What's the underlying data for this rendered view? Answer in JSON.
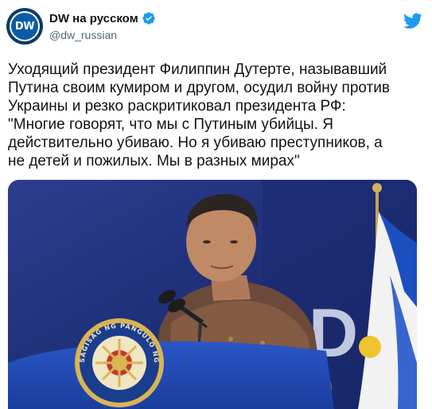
{
  "account": {
    "display_name": "DW на русском",
    "handle": "@dw_russian",
    "avatar_text": "DW",
    "verified": true
  },
  "tweet": {
    "text": "Уходящий президент Филиппин Дутерте, называвший\nПутина своим кумиром и другом, осудил войну против\nУкраины и резко раскритиковал президента РФ:\n\"Многие говорят, что мы с Путиным убийцы. Я\nдействительно убиваю. Но я убиваю преступников, а\nне детей и пожилых. Мы в разных мирах\""
  },
  "media": {
    "seal_text": "SAGISAG NG PANGULO NG PILIPINAS",
    "backdrop_text": "D"
  },
  "icons": {
    "verified": "verified-badge-icon",
    "twitter": "twitter-bird-icon"
  },
  "colors": {
    "verified_blue": "#1d9bf0",
    "twitter_blue": "#1d9bf0",
    "dw_blue": "#0a5da3"
  }
}
